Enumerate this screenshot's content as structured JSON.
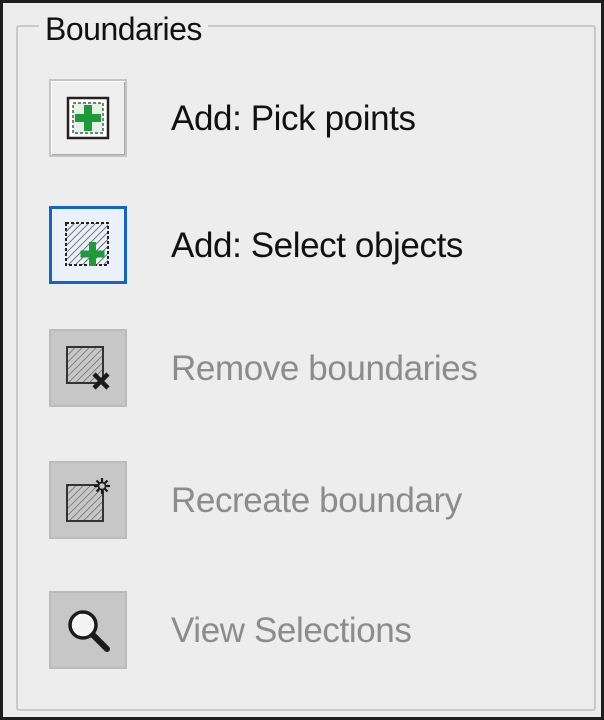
{
  "group": {
    "title": "Boundaries"
  },
  "buttons": [
    {
      "label": "Add: Pick points",
      "icon": "add-pick-points-icon",
      "state": "enabled"
    },
    {
      "label": "Add: Select objects",
      "icon": "add-select-objects-icon",
      "state": "focused"
    },
    {
      "label": "Remove boundaries",
      "icon": "remove-boundaries-icon",
      "state": "disabled"
    },
    {
      "label": "Recreate boundary",
      "icon": "recreate-boundary-icon",
      "state": "disabled"
    },
    {
      "label": "View Selections",
      "icon": "magnifier-icon",
      "state": "disabled"
    }
  ],
  "colors": {
    "panel_bg": "#ededed",
    "focus_border": "#1464c8",
    "add_green": "#1e9a3a",
    "disabled_text": "#8c8c8c"
  }
}
